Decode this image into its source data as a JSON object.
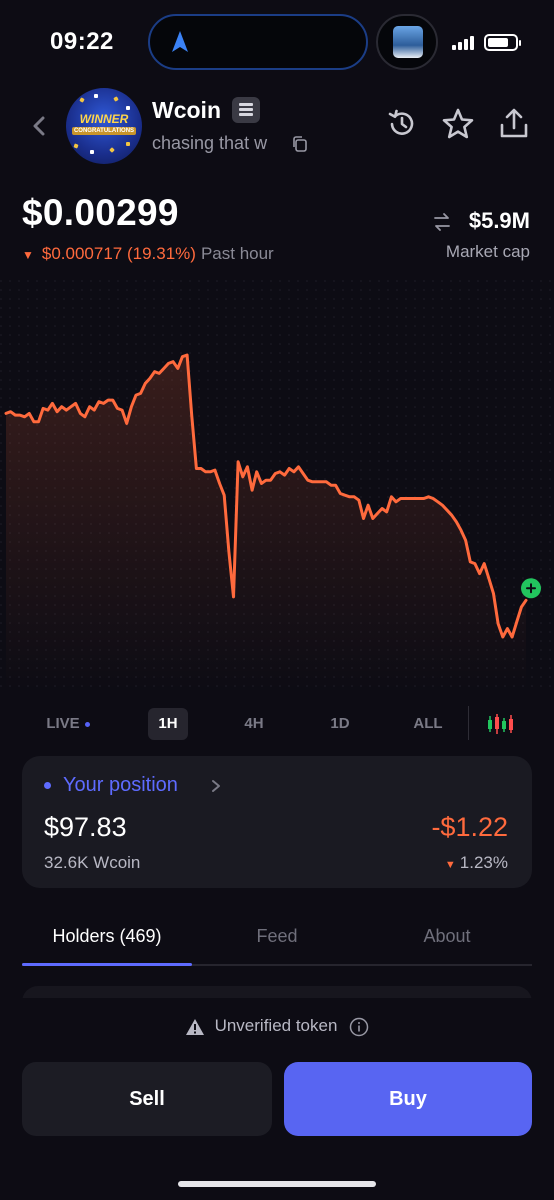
{
  "status_bar": {
    "time": "09:22"
  },
  "header": {
    "token_name": "Wcoin",
    "subtitle": "chasing that w",
    "avatar_text": {
      "line1": "WINNER",
      "line2": "CONGRATULATIONS"
    },
    "icons": [
      "back-icon",
      "history-icon",
      "star-icon",
      "share-icon",
      "copy-icon",
      "chain-icon"
    ]
  },
  "price": {
    "current": "$0.00299",
    "change": "$0.000717 (19.31%)",
    "change_period": "Past hour",
    "market_cap": "$5.9M",
    "market_cap_label": "Market cap"
  },
  "colors": {
    "accent": "#5e6bff",
    "negative": "#ff6a3d",
    "positive": "#22c55e",
    "buy_button": "#5865f2",
    "background": "#0d0c14"
  },
  "chart_data": {
    "type": "line",
    "title": "",
    "xlabel": "",
    "ylabel": "",
    "y": [
      0.00368,
      0.00369,
      0.00367,
      0.00367,
      0.00366,
      0.00368,
      0.00363,
      0.00363,
      0.00371,
      0.0037,
      0.00374,
      0.00369,
      0.00372,
      0.0037,
      0.00372,
      0.00374,
      0.00368,
      0.00366,
      0.00372,
      0.0037,
      0.00375,
      0.00374,
      0.00376,
      0.00376,
      0.00371,
      0.0037,
      0.00362,
      0.00372,
      0.00379,
      0.0038,
      0.00386,
      0.00389,
      0.00393,
      0.00392,
      0.00395,
      0.00398,
      0.00399,
      0.00395,
      0.00402,
      0.00403,
      0.00367,
      0.00335,
      0.00335,
      0.00333,
      0.00333,
      0.00334,
      0.00326,
      0.00319,
      0.00285,
      0.00258,
      0.00339,
      0.0033,
      0.00336,
      0.00322,
      0.00333,
      0.00326,
      0.00328,
      0.00328,
      0.00332,
      0.00333,
      0.00331,
      0.00335,
      0.00333,
      0.00336,
      0.00332,
      0.00328,
      0.00327,
      0.00327,
      0.00327,
      0.00327,
      0.00325,
      0.00325,
      0.0032,
      0.00319,
      0.00318,
      0.00318,
      0.00316,
      0.00305,
      0.00313,
      0.00305,
      0.00308,
      0.00311,
      0.00309,
      0.00318,
      0.00315,
      0.00317,
      0.00317,
      0.00317,
      0.00317,
      0.00317,
      0.00317,
      0.00318,
      0.00317,
      0.00315,
      0.00313,
      0.0031,
      0.00307,
      0.00303,
      0.00298,
      0.00292,
      0.00279,
      0.00278,
      0.00272,
      0.00278,
      0.00269,
      0.0026,
      0.00242,
      0.00234,
      0.00239,
      0.00234,
      0.00243,
      0.00252,
      0.00256
    ],
    "ylim": [
      0.00225,
      0.00415
    ],
    "grid": false
  },
  "timeframes": {
    "live": "LIVE",
    "options": [
      "1H",
      "4H",
      "1D",
      "ALL"
    ],
    "selected": "1H"
  },
  "position": {
    "title": "Your position",
    "value": "$97.83",
    "amount": "32.6K Wcoin",
    "pnl": "-$1.22",
    "pnl_pct": "1.23%"
  },
  "tabs": [
    {
      "label": "Holders (469)",
      "active": true
    },
    {
      "label": "Feed",
      "active": false
    },
    {
      "label": "About",
      "active": false
    }
  ],
  "footer": {
    "unverified": "Unverified token",
    "sell": "Sell",
    "buy": "Buy"
  }
}
